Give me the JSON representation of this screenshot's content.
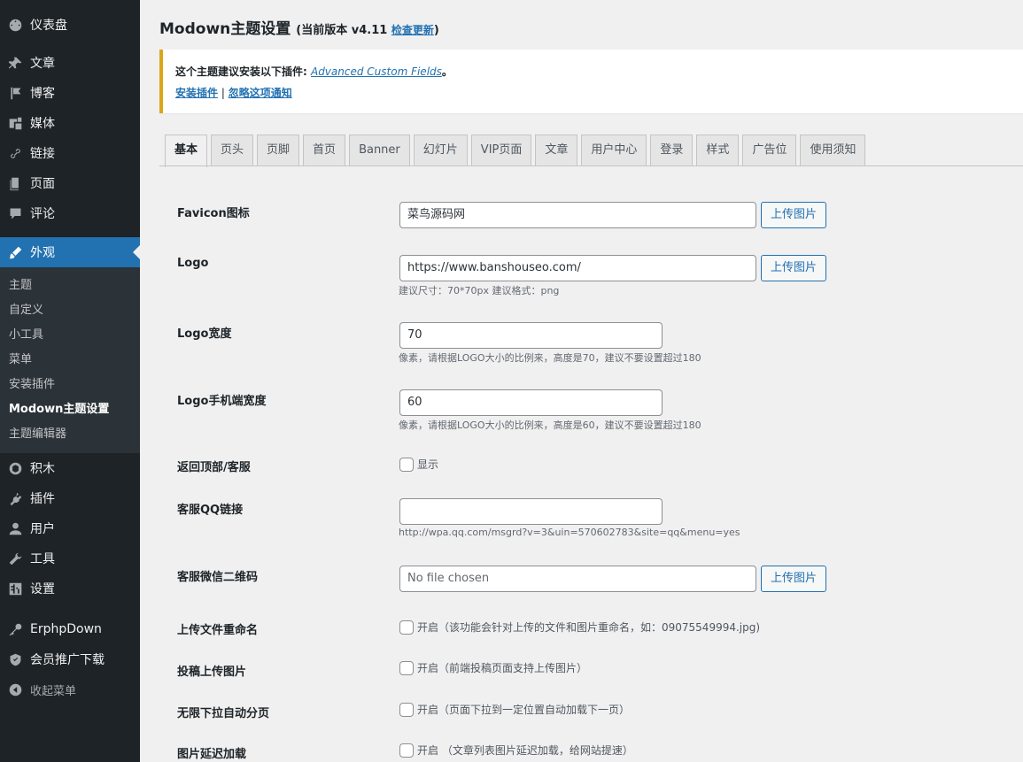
{
  "sidebar": {
    "top": [
      {
        "label": "仪表盘",
        "icon": "dashboard-icon"
      },
      {
        "label": "文章",
        "icon": "pin-icon"
      },
      {
        "label": "博客",
        "icon": "flag-icon"
      },
      {
        "label": "媒体",
        "icon": "media-icon"
      },
      {
        "label": "链接",
        "icon": "link-icon"
      },
      {
        "label": "页面",
        "icon": "page-icon"
      },
      {
        "label": "评论",
        "icon": "comment-icon"
      }
    ],
    "current": {
      "label": "外观",
      "icon": "brush-icon"
    },
    "submenu": [
      "主题",
      "自定义",
      "小工具",
      "菜单",
      "安装插件",
      "Modown主题设置",
      "主题编辑器"
    ],
    "bottom": [
      {
        "label": "积木",
        "icon": "blocks-icon"
      },
      {
        "label": "插件",
        "icon": "plugin-icon"
      },
      {
        "label": "用户",
        "icon": "user-icon"
      },
      {
        "label": "工具",
        "icon": "wrench-icon"
      },
      {
        "label": "设置",
        "icon": "settings-icon"
      },
      {
        "label": "ErphpDown",
        "icon": "key-icon"
      },
      {
        "label": "会员推广下载",
        "icon": "shield-icon"
      },
      {
        "label": "收起菜单",
        "icon": "collapse-icon"
      }
    ]
  },
  "header": {
    "title": "Modown主题设置",
    "version_prefix": "(当前版本 v4.11 ",
    "check_update": "检查更新",
    "version_suffix": ")"
  },
  "notice": {
    "text": "这个主题建议安装以下插件: ",
    "plugin": "Advanced Custom Fields",
    "period": "。",
    "install": "安装插件",
    "sep": " | ",
    "dismiss": "忽略这项通知"
  },
  "tabs": [
    "基本",
    "页头",
    "页脚",
    "首页",
    "Banner",
    "幻灯片",
    "VIP页面",
    "文章",
    "用户中心",
    "登录",
    "样式",
    "广告位",
    "使用须知"
  ],
  "form": {
    "favicon_label": "Favicon图标",
    "favicon_value": "菜鸟源码网",
    "upload_btn": "上传图片",
    "logo_label": "Logo",
    "logo_value": "https://www.banshouseo.com/",
    "logo_desc": "建议尺寸：70*70px 建议格式：png",
    "logo_width_label": "Logo宽度",
    "logo_width_value": "70",
    "logo_width_desc": "像素，请根据LOGO大小的比例来，高度是70，建议不要设置超过180",
    "logo_mobile_label": "Logo手机端宽度",
    "logo_mobile_value": "60",
    "logo_mobile_desc": "像素，请根据LOGO大小的比例来，高度是60，建议不要设置超过180",
    "backtop_label": "返回顶部/客服",
    "backtop_check": "显示",
    "qq_label": "客服QQ链接",
    "qq_value": "",
    "qq_desc": "http://wpa.qq.com/msgrd?v=3&uin=570602783&site=qq&menu=yes",
    "wechat_label": "客服微信二维码",
    "wechat_value": "No file chosen",
    "rename_label": "上传文件重命名",
    "rename_check": "开启（该功能会针对上传的文件和图片重命名，如：09075549994.jpg)",
    "contrib_label": "投稿上传图片",
    "contrib_check": "开启（前端投稿页面支持上传图片）",
    "infinite_label": "无限下拉自动分页",
    "infinite_check": "开启（页面下拉到一定位置自动加载下一页）",
    "lazy_label": "图片延迟加载",
    "lazy_check": "开启 （文章列表图片延迟加载，给网站提速）"
  }
}
